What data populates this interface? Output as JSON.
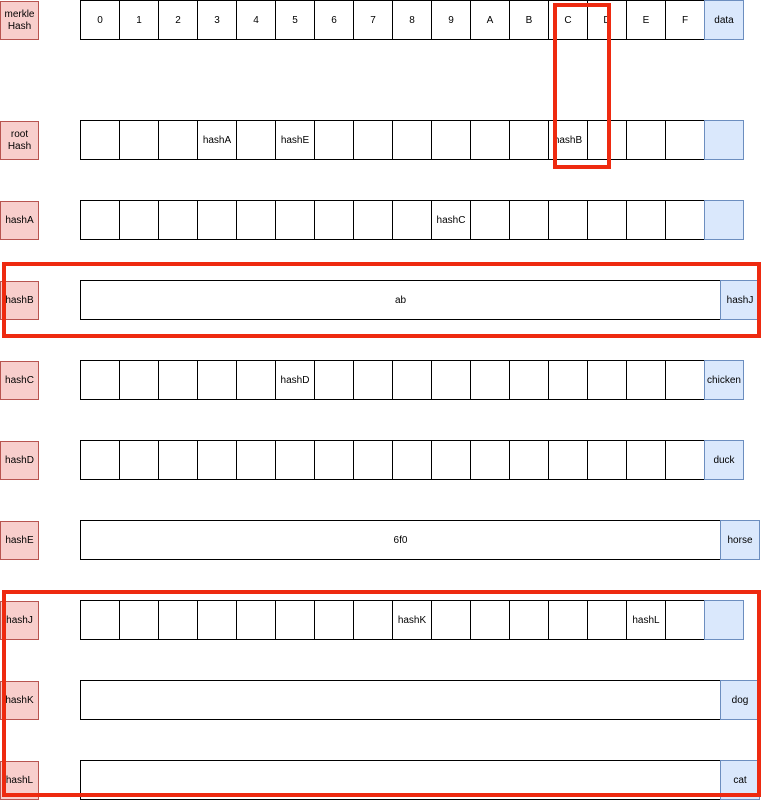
{
  "rows": [
    {
      "label": "merkle\nHash",
      "kind": "cells",
      "cells": [
        "0",
        "1",
        "2",
        "3",
        "4",
        "5",
        "6",
        "7",
        "8",
        "9",
        "A",
        "B",
        "C",
        "D",
        "E",
        "F"
      ],
      "data": "data"
    },
    {
      "label": "root\nHash",
      "kind": "cells",
      "cells": [
        "",
        "",
        "",
        "hashA",
        "",
        "hashE",
        "",
        "",
        "",
        "",
        "",
        "",
        "hashB",
        "",
        "",
        ""
      ],
      "data": ""
    },
    {
      "label": "hashA",
      "kind": "cells",
      "cells": [
        "",
        "",
        "",
        "",
        "",
        "",
        "",
        "",
        "",
        "hashC",
        "",
        "",
        "",
        "",
        "",
        ""
      ],
      "data": ""
    },
    {
      "label": "hashB",
      "kind": "wide",
      "value": "ab",
      "data": "hashJ"
    },
    {
      "label": "hashC",
      "kind": "cells",
      "cells": [
        "",
        "",
        "",
        "",
        "",
        "hashD",
        "",
        "",
        "",
        "",
        "",
        "",
        "",
        "",
        "",
        ""
      ],
      "data": "chicken"
    },
    {
      "label": "hashD",
      "kind": "cells",
      "cells": [
        "",
        "",
        "",
        "",
        "",
        "",
        "",
        "",
        "",
        "",
        "",
        "",
        "",
        "",
        "",
        ""
      ],
      "data": "duck"
    },
    {
      "label": "hashE",
      "kind": "wide",
      "value": "6f0",
      "data": "horse"
    },
    {
      "label": "hashJ",
      "kind": "cells",
      "cells": [
        "",
        "",
        "",
        "",
        "",
        "",
        "",
        "",
        "hashK",
        "",
        "",
        "",
        "",
        "",
        "hashL",
        ""
      ],
      "data": ""
    },
    {
      "label": "hashK",
      "kind": "wide",
      "value": "",
      "data": "dog"
    },
    {
      "label": "hashL",
      "kind": "wide",
      "value": "",
      "data": "cat"
    }
  ],
  "colors": {
    "label_fill": "#f8cecc",
    "label_border": "#b85450",
    "data_fill": "#dae8fc",
    "data_border": "#6c8ebf",
    "highlight": "#ee2a10"
  }
}
